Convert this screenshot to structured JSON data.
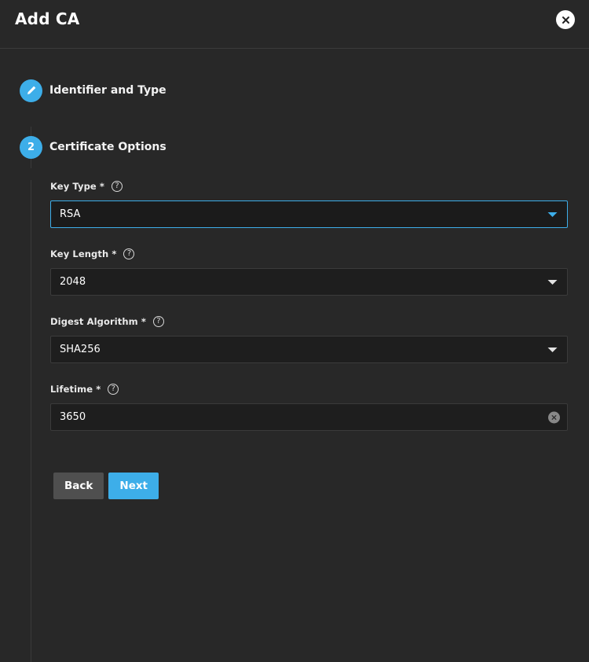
{
  "window": {
    "title": "Add CA",
    "close_icon": "close-icon"
  },
  "stepper": {
    "steps": [
      {
        "marker": "",
        "icon": "pencil-icon",
        "label": "Identifier and Type",
        "state": "completed"
      },
      {
        "marker": "2",
        "icon": "",
        "label": "Certificate Options",
        "state": "active"
      }
    ]
  },
  "form": {
    "fields": [
      {
        "label": "Key Type *",
        "help_icon": "help-icon",
        "type": "select",
        "value": "RSA",
        "focused": true,
        "caret_icon": "chevron-down-icon"
      },
      {
        "label": "Key Length *",
        "help_icon": "help-icon",
        "type": "select",
        "value": "2048",
        "focused": false,
        "caret_icon": "chevron-down-icon"
      },
      {
        "label": "Digest Algorithm *",
        "help_icon": "help-icon",
        "type": "select",
        "value": "SHA256",
        "focused": false,
        "caret_icon": "chevron-down-icon"
      },
      {
        "label": "Lifetime *",
        "help_icon": "help-icon",
        "type": "text",
        "value": "3650",
        "focused": false,
        "clear_icon": "clear-icon"
      }
    ]
  },
  "actions": {
    "back_label": "Back",
    "next_label": "Next"
  },
  "colors": {
    "accent": "#3daee9",
    "background": "#282828",
    "field_background": "#1e1e1e",
    "button_secondary": "#4f4f4f"
  }
}
